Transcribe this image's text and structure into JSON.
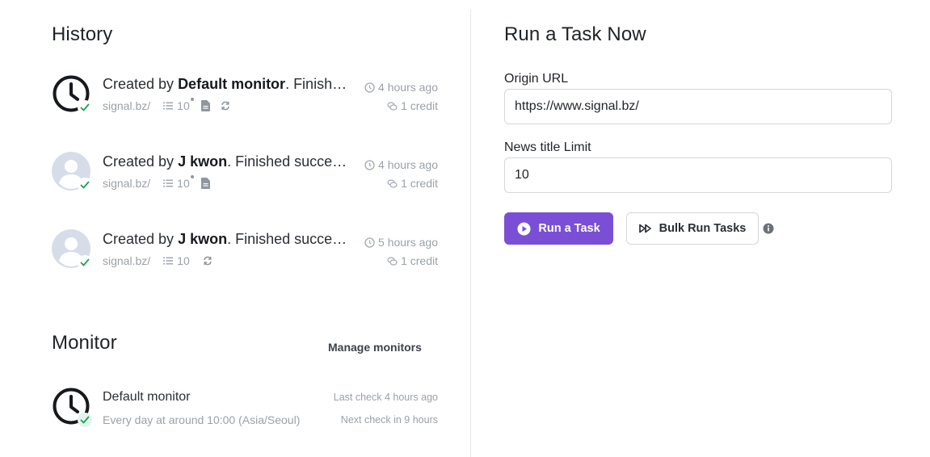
{
  "history": {
    "title": "History",
    "items": [
      {
        "avatar": "clock-icon",
        "prefix": "Created by ",
        "author": "Default monitor",
        "suffix": ". Finished successfully",
        "site": "signal.bz/",
        "count": "10",
        "time": "4 hours ago",
        "credit": "1 credit",
        "icons": [
          "list-icon",
          "document-icon",
          "refresh-icon"
        ]
      },
      {
        "avatar": "user-avatar",
        "prefix": "Created by ",
        "author": "J kwon",
        "suffix": ". Finished successfully",
        "site": "signal.bz/",
        "count": "10",
        "time": "4 hours ago",
        "credit": "1 credit",
        "icons": [
          "list-icon",
          "document-icon"
        ]
      },
      {
        "avatar": "user-avatar",
        "prefix": "Created by ",
        "author": "J kwon",
        "suffix": ". Finished successfully",
        "site": "signal.bz/",
        "count": "10",
        "time": "5 hours ago",
        "credit": "1 credit",
        "icons": [
          "list-icon",
          "refresh-icon"
        ]
      }
    ]
  },
  "monitor": {
    "title": "Monitor",
    "manage_label": "Manage monitors",
    "name": "Default monitor",
    "schedule": "Every day at around 10:00 (Asia/Seoul)",
    "last_check": "Last check 4 hours ago",
    "next_check": "Next check in 9 hours"
  },
  "run": {
    "title": "Run a Task Now",
    "origin_label": "Origin URL",
    "origin_value": "https://www.signal.bz/",
    "limit_label": "News title Limit",
    "limit_value": "10",
    "run_label": "Run a Task",
    "bulk_label": "Bulk Run Tasks"
  },
  "colors": {
    "accent": "#7a4fd6",
    "success": "#1e9e5a",
    "muted": "#9aa1a9"
  }
}
